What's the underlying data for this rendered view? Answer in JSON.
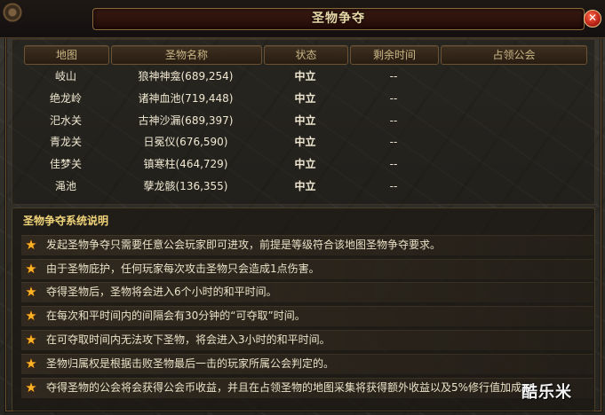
{
  "window": {
    "title": "圣物争夺"
  },
  "table": {
    "headers": [
      "地图",
      "圣物名称",
      "状态",
      "剩余时间",
      "占领公会"
    ],
    "rows": [
      {
        "map": "岐山",
        "relic": "狼神神龛(689,254)",
        "state": "中立",
        "remaining": "--",
        "guild": ""
      },
      {
        "map": "绝龙岭",
        "relic": "诸神血池(719,448)",
        "state": "中立",
        "remaining": "--",
        "guild": ""
      },
      {
        "map": "汜水关",
        "relic": "古神沙漏(689,397)",
        "state": "中立",
        "remaining": "--",
        "guild": ""
      },
      {
        "map": "青龙关",
        "relic": "日冕仪(676,590)",
        "state": "中立",
        "remaining": "--",
        "guild": ""
      },
      {
        "map": "佳梦关",
        "relic": "镇寒柱(464,729)",
        "state": "中立",
        "remaining": "--",
        "guild": ""
      },
      {
        "map": "渑池",
        "relic": "孽龙骸(136,355)",
        "state": "中立",
        "remaining": "--",
        "guild": ""
      }
    ]
  },
  "rules": {
    "title": "圣物争夺系统说明",
    "items": [
      "发起圣物争夺只需要任意公会玩家即可进攻，前提是等级符合该地图圣物争夺要求。",
      "由于圣物庇护，任何玩家每次攻击圣物只会造成1点伤害。",
      "夺得圣物后，圣物将会进入6个小时的和平时间。",
      "在每次和平时间内的间隔会有30分钟的“可夺取”时间。",
      "在可夺取时间内无法攻下圣物，将会进入3小时的和平时间。",
      "圣物归属权是根据击败圣物最后一击的玩家所属公会判定的。",
      "夺得圣物的公会将会获得公会币收益，并且在占领圣物的地图采集将获得额外收益以及5%修行值加成。"
    ]
  },
  "icons": {
    "close": "close-icon",
    "bullet": "star-icon"
  },
  "watermark": "酷乐米",
  "colors": {
    "accent": "#e8d9a8",
    "star": "#ffb326",
    "rules_title": "#f0d47a",
    "close": "#c0261a"
  }
}
